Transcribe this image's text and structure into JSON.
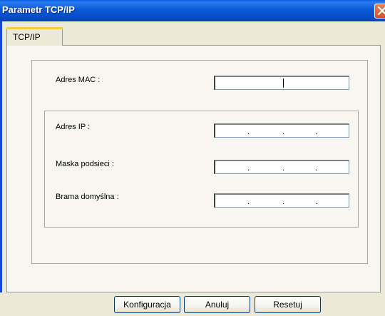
{
  "window": {
    "title": "Parametr TCP/IP"
  },
  "tabs": [
    {
      "label": "TCP/IP"
    }
  ],
  "fields": {
    "mac": {
      "label": "Adres MAC :",
      "value": ""
    },
    "ip": {
      "label": "Adres IP :",
      "dots": [
        ".",
        ".",
        "."
      ]
    },
    "subnet": {
      "label": "Maska podsieci :",
      "dots": [
        ".",
        ".",
        "."
      ]
    },
    "gateway": {
      "label": "Brama domyślna :",
      "dots": [
        ".",
        ".",
        "."
      ]
    }
  },
  "buttons": {
    "configure": "Konfiguracja",
    "cancel": "Anuluj",
    "reset": "Resetuj"
  },
  "icons": {
    "close": "close-icon"
  },
  "colors": {
    "titlebar": "#0a5ad6",
    "close": "#d4532a",
    "tab_highlight": "#ffc83c"
  }
}
